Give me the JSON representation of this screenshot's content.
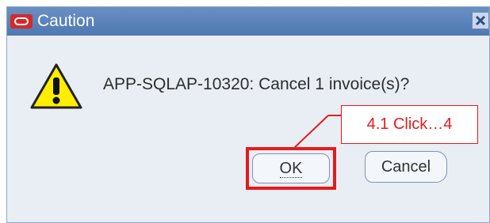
{
  "dialog": {
    "title": "Caution",
    "message": "APP-SQLAP-10320: Cancel 1 invoice(s)?",
    "icons": {
      "app": "oracle-logo-icon",
      "close": "close-icon",
      "warning": "warning-icon"
    }
  },
  "buttons": {
    "ok_label": "OK",
    "cancel_label": "Cancel"
  },
  "annotation": {
    "callout_text": "4.1 Click…4"
  },
  "colors": {
    "titlebar": "#5a82bb",
    "highlight": "#e41b1b",
    "dialog_bg": "#e9eef5"
  }
}
